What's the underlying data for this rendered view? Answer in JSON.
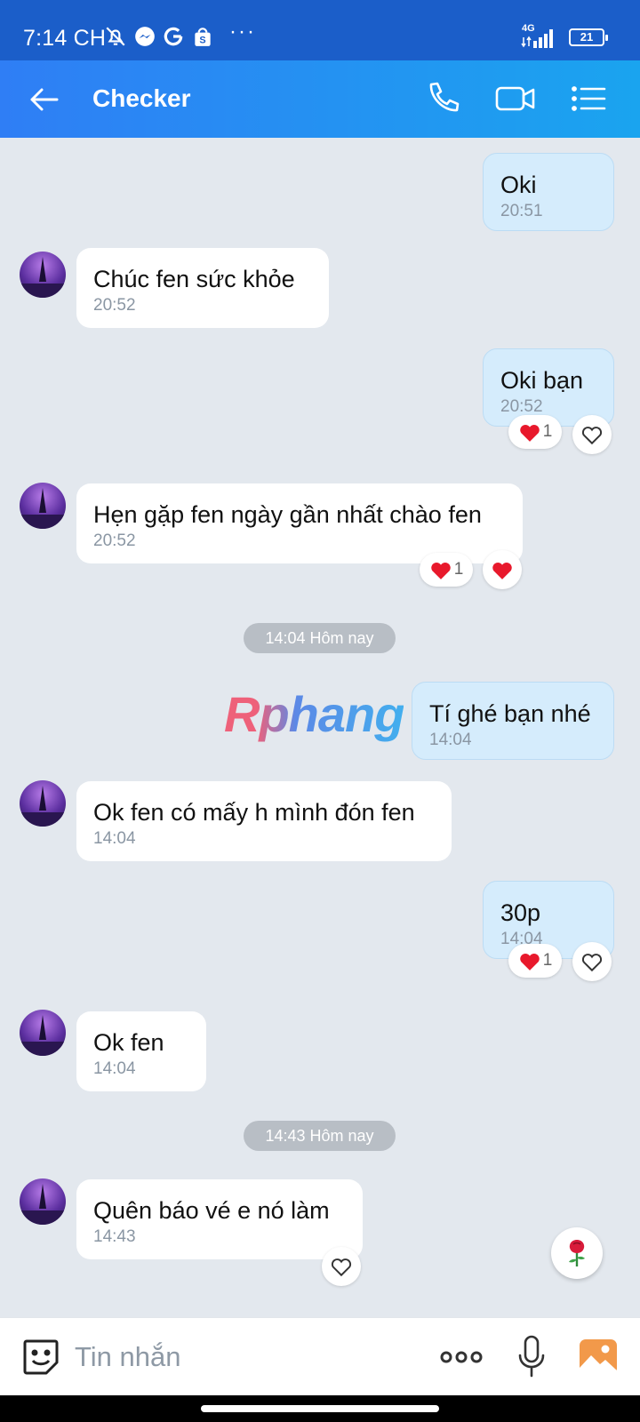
{
  "status_bar": {
    "time": "7:14 CH",
    "network": "4G",
    "battery": "21",
    "more": "···"
  },
  "header": {
    "title": "Checker",
    "back_icon": "arrow-left-icon",
    "call_icon": "phone-icon",
    "video_icon": "video-camera-icon",
    "menu_icon": "list-menu-icon"
  },
  "messages": [
    {
      "dir": "out",
      "text": "Oki",
      "time": "20:51"
    },
    {
      "dir": "in",
      "text": "Chúc fen sức khỏe",
      "time": "20:52"
    },
    {
      "dir": "out",
      "text": "Oki bạn",
      "time": "20:52",
      "reaction_count": "1"
    },
    {
      "dir": "in",
      "text": "Hẹn gặp fen ngày gần nhất chào fen",
      "time": "20:52",
      "reaction_count": "1"
    },
    {
      "dir": "out",
      "text": "Tí ghé bạn nhé",
      "time": "14:04"
    },
    {
      "dir": "in",
      "text": "Ok fen có mấy h mình đón fen",
      "time": "14:04"
    },
    {
      "dir": "out",
      "text": "30p",
      "time": "14:04",
      "reaction_count": "1"
    },
    {
      "dir": "in",
      "text": "Ok fen",
      "time": "14:04"
    },
    {
      "dir": "in",
      "text": "Quên báo vé e nó làm",
      "time": "14:43"
    }
  ],
  "dividers": [
    "14:04 Hôm nay",
    "14:43 Hôm nay"
  ],
  "watermark": "Rphang",
  "composer": {
    "placeholder": "Tin nhắn",
    "sticker_icon": "sticker-smile-icon",
    "more_icon": "more-dots-icon",
    "mic_icon": "microphone-icon",
    "gallery_icon": "image-gallery-icon"
  },
  "colors": {
    "header_start": "#2f7ef5",
    "header_end": "#1aa4ef",
    "outgoing_bubble": "#d5ecfc",
    "incoming_bubble": "#ffffff",
    "chat_background": "#e3e8ee",
    "heart": "#e8192c"
  }
}
